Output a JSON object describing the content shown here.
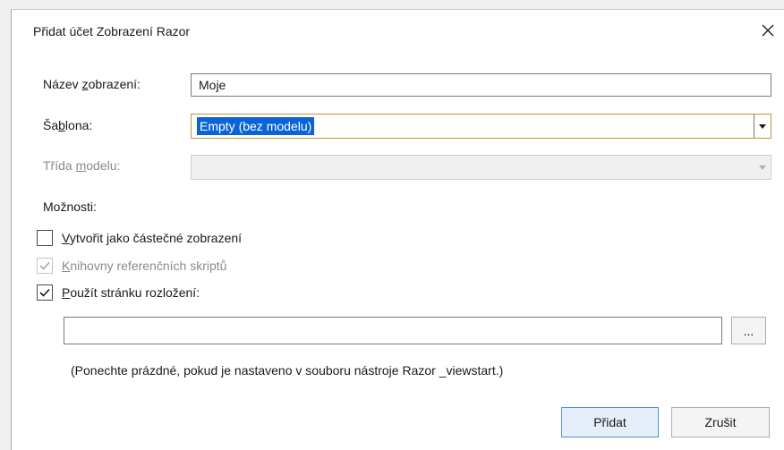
{
  "window": {
    "title": "Přidat účet Zobrazení Razor",
    "close_icon": "close-icon"
  },
  "form": {
    "view_name": {
      "label_pre": "Název ",
      "label_key": "z",
      "label_post": "obrazení:",
      "value": "Moje"
    },
    "template": {
      "label_pre": "Ša",
      "label_key": "b",
      "label_post": "lona:",
      "value": "Empty (bez modelu)"
    },
    "model_class": {
      "label_pre": "Třída ",
      "label_key": "m",
      "label_post": "odelu:",
      "value": ""
    },
    "options_label": "Možnosti:"
  },
  "options": {
    "partial": {
      "label_key": "V",
      "label_post": "ytvořit jako částečné zobrazení",
      "checked": false,
      "enabled": true
    },
    "script_libs": {
      "label_key": "K",
      "label_post": "nihovny referenčních skriptů",
      "checked": true,
      "enabled": false
    },
    "layout": {
      "label_key": "P",
      "label_post": "oužít stránku rozložení:",
      "checked": true,
      "enabled": true
    },
    "layout_path": "",
    "browse_label": "...",
    "hint": "(Ponechte prázdné, pokud je nastaveno v souboru nástroje Razor _viewstart.)"
  },
  "buttons": {
    "add": "Přidat",
    "cancel": "Zrušit"
  },
  "colors": {
    "focus_border": "#c9923f",
    "selection": "#0a64d6",
    "primary_border": "#5a8fd6"
  }
}
